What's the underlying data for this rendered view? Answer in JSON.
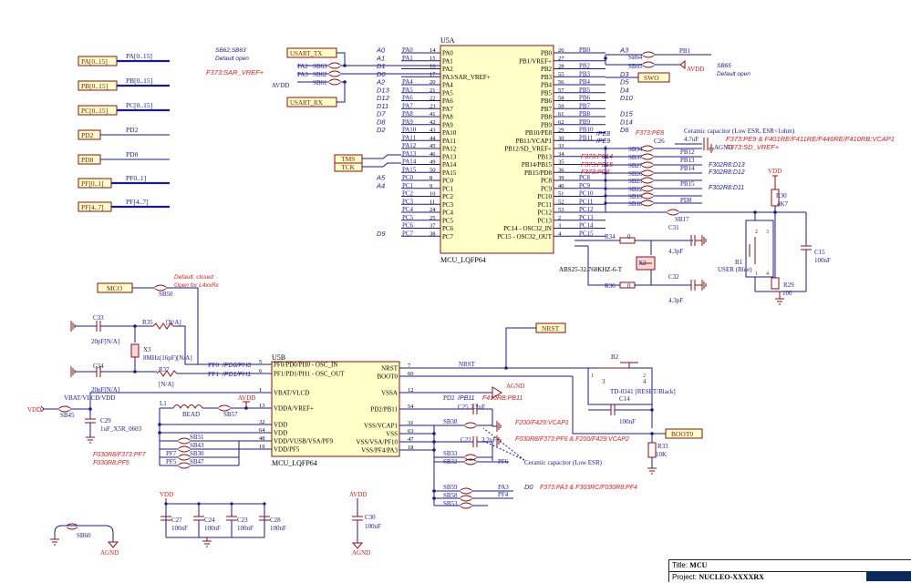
{
  "colors": {
    "net": "#1a1a8c",
    "part": "#8a1010",
    "alt": "#d42020",
    "label": "#7a1a1a",
    "chip_fill": "#ffffc8"
  },
  "u5a": {
    "ref": "U5A",
    "name": "MCU_LQFP64",
    "left_pins": [
      {
        "net": "PA0",
        "num": "14",
        "pin": "PA0",
        "alt": "A0"
      },
      {
        "net": "PA1",
        "num": "15",
        "pin": "PA1",
        "alt": "A1"
      },
      {
        "net": "",
        "num": "16",
        "pin": "PA2",
        "alt": "D1"
      },
      {
        "net": "",
        "num": "17",
        "pin": "PA3/SAR_VREF+",
        "alt": "D0"
      },
      {
        "net": "PA4",
        "num": "20",
        "pin": "PA4",
        "alt": "A2"
      },
      {
        "net": "PA5",
        "num": "21",
        "pin": "PA5",
        "alt": "D13"
      },
      {
        "net": "PA6",
        "num": "22",
        "pin": "PA6",
        "alt": "D12"
      },
      {
        "net": "PA7",
        "num": "23",
        "pin": "PA7",
        "alt": "D11"
      },
      {
        "net": "PA8",
        "num": "41",
        "pin": "PA8",
        "alt": "D7"
      },
      {
        "net": "PA9",
        "num": "42",
        "pin": "PA9",
        "alt": "D8"
      },
      {
        "net": "PA10",
        "num": "43",
        "pin": "PA10",
        "alt": "D2"
      },
      {
        "net": "PA11",
        "num": "44",
        "pin": "PA11",
        "alt": ""
      },
      {
        "net": "PA12",
        "num": "45",
        "pin": "PA12",
        "alt": ""
      },
      {
        "net": "PA13",
        "num": "46",
        "pin": "PA13",
        "alt": ""
      },
      {
        "net": "PA14",
        "num": "49",
        "pin": "PA14",
        "alt": ""
      },
      {
        "net": "PA15",
        "num": "50",
        "pin": "PA15",
        "alt": ""
      },
      {
        "net": "PC0",
        "num": "8",
        "pin": "PC0",
        "alt": "A5"
      },
      {
        "net": "PC1",
        "num": "9",
        "pin": "PC1",
        "alt": "A4"
      },
      {
        "net": "PC2",
        "num": "10",
        "pin": "PC2",
        "alt": ""
      },
      {
        "net": "PC3",
        "num": "11",
        "pin": "PC3",
        "alt": ""
      },
      {
        "net": "PC4",
        "num": "24",
        "pin": "PC4",
        "alt": ""
      },
      {
        "net": "PC5",
        "num": "25",
        "pin": "PC5",
        "alt": ""
      },
      {
        "net": "PC6",
        "num": "37",
        "pin": "PC6",
        "alt": ""
      },
      {
        "net": "PC7",
        "num": "38",
        "pin": "PC7",
        "alt": "D9"
      }
    ],
    "right_pins": [
      {
        "pin": "PB0",
        "num": "26",
        "net": "PB0",
        "alt": "A3"
      },
      {
        "pin": "PB1/VREF+",
        "num": "27",
        "net": "",
        "alt": ""
      },
      {
        "pin": "PB2",
        "num": "28",
        "net": "PB2",
        "alt": ""
      },
      {
        "pin": "PB3",
        "num": "55",
        "net": "PB3",
        "alt": "D3"
      },
      {
        "pin": "PB4",
        "num": "56",
        "net": "PB4",
        "alt": "D5"
      },
      {
        "pin": "PB5",
        "num": "57",
        "net": "PB5",
        "alt": "D4"
      },
      {
        "pin": "PB6",
        "num": "58",
        "net": "PB6",
        "alt": "D10"
      },
      {
        "pin": "PB7",
        "num": "59",
        "net": "PB7",
        "alt": ""
      },
      {
        "pin": "PB8",
        "num": "61",
        "net": "PB8",
        "alt": "D15"
      },
      {
        "pin": "PB9",
        "num": "62",
        "net": "PB9",
        "alt": "D14"
      },
      {
        "pin": "PB10/PE8",
        "num": "29",
        "net": "PB10",
        "alt": "D6"
      },
      {
        "pin": "PB11/VCAP1",
        "num": "30",
        "net": "PB11",
        "alt": ""
      },
      {
        "pin": "PB12/SD_VREF+",
        "num": "33",
        "net": "",
        "alt": ""
      },
      {
        "pin": "PB13",
        "num": "34",
        "net": "",
        "alt": ""
      },
      {
        "pin": "PB14/PB15",
        "num": "35",
        "net": "",
        "alt": ""
      },
      {
        "pin": "PB15/PD8",
        "num": "36",
        "net": "",
        "alt": ""
      },
      {
        "pin": "PC8",
        "num": "39",
        "net": "PC8",
        "alt": ""
      },
      {
        "pin": "PC9",
        "num": "40",
        "net": "PC9",
        "alt": ""
      },
      {
        "pin": "PC10",
        "num": "51",
        "net": "PC10",
        "alt": ""
      },
      {
        "pin": "PC11",
        "num": "52",
        "net": "PC11",
        "alt": ""
      },
      {
        "pin": "PC12",
        "num": "53",
        "net": "PC12",
        "alt": ""
      },
      {
        "pin": "PC13",
        "num": "2",
        "net": "PC13",
        "alt": ""
      },
      {
        "pin": "PC14 - OSC32_IN",
        "num": "3",
        "net": "PC14",
        "alt": ""
      },
      {
        "pin": "PC15 - OSC32_OUT",
        "num": "4",
        "net": "PC15",
        "alt": ""
      }
    ]
  },
  "u5b": {
    "ref": "U5B",
    "name": "MCU_LQFP64",
    "left_pins": [
      {
        "pin": "PF0/PD0/PH0 - OSC_IN",
        "num": "5"
      },
      {
        "pin": "PF1/PD1/PH1 - OSC_OUT",
        "num": "6"
      },
      {
        "pin": "VBAT/VLCD",
        "num": "1"
      },
      {
        "pin": "VDDA/VREF+",
        "num": "13"
      },
      {
        "pin": "VDD",
        "num": "32"
      },
      {
        "pin": "VDD",
        "num": "64"
      },
      {
        "pin": "VDD/VUSB/VSA/PF9",
        "num": "48"
      },
      {
        "pin": "VDD/PF5",
        "num": "19"
      }
    ],
    "right_pins": [
      {
        "pin": "NRST",
        "num": "7"
      },
      {
        "pin": "BOOT0",
        "num": "60"
      },
      {
        "pin": "VSSA",
        "num": "12"
      },
      {
        "pin": "PD2/PB11",
        "num": "54"
      },
      {
        "pin": "VSS/VCAP1",
        "num": "31"
      },
      {
        "pin": "VSS",
        "num": "63"
      },
      {
        "pin": "VSS/VSA/PF10",
        "num": "47"
      },
      {
        "pin": "VSS/PF4/PA3",
        "num": "18"
      }
    ]
  },
  "buses": [
    {
      "port": "PA[0..15]",
      "label": "PA[0..15]"
    },
    {
      "port": "PB[0..15]",
      "label": "PB[0..15]"
    },
    {
      "port": "PC[0..15]",
      "label": "PC[0..15]"
    },
    {
      "port": "PD2",
      "label": "PD2"
    },
    {
      "port": "PD8",
      "label": "PD8"
    },
    {
      "port": "PF[0..1]",
      "label": "PF0..1]"
    },
    {
      "port": "PF[4..7]",
      "label": "PF[4..7]"
    }
  ],
  "ports": {
    "usart_tx": "USART_TX",
    "usart_rx": "USART_RX",
    "tms": "TMS",
    "tck": "TCK",
    "swo": "SWO",
    "mco": "MCO",
    "nrst": "NRST",
    "boot0": "BOOT0"
  },
  "labels": {
    "sb62_63": "SB62,SB63",
    "default_open": "Default open",
    "f373_sar": "F373:SAR_VREF+",
    "sb63": "SB63",
    "sb62": "SB62",
    "sb61": "SB61",
    "pa2": "PA2",
    "pa3": "PA3",
    "avdd": "AVDD",
    "vdd": "VDD",
    "agnd": "AGND",
    "sb64": "SB64",
    "sb65": "SB65",
    "pb1": "PB1",
    "sb65_note": "SB65",
    "default_open2": "Default open",
    "f373_pe8": "F373:PE8",
    "pe8": "/PE8",
    "pe9": "/PE9",
    "ceramic1": "Ceramic capacitor (Low ESR, ESR<1ohm)",
    "c26": "C26",
    "c26v": "4.7uF",
    "f373_pe9": "F373:PE9 & F401RE/F411RE/F446RE/F410RB:VCAP1",
    "f373_sd": "F373:SD_VREF+",
    "f373_pb14": "F373:PB14",
    "f373_pb15": "F373:PB15",
    "f373_pd8": "F373:PD8",
    "sb34": "SB34",
    "sb37": "SB37",
    "sb27": "SB27",
    "sb26": "SB26",
    "sb23": "SB23",
    "sb22": "SB22",
    "sb19": "SB19",
    "sb18": "SB18",
    "sb17": "SB17",
    "pb12": "PB12",
    "pb13": "PB13",
    "pb14": "PB14",
    "pb15": "PB15",
    "pd8": "PD8",
    "f302_d13": "F302R8:D13",
    "f302_d12": "F302R8:D12",
    "f302_d11": "F302R8:D11",
    "vdd_top": "VDD",
    "r30": "R30",
    "r30v": "4K7",
    "r34": "R34",
    "r34v": "0",
    "c31": "C31",
    "c31v": "4.3pF",
    "x2": "X2",
    "x2v": "ABS25-32.768KHZ-6-T",
    "c32": "C32",
    "c32v": "4.3pF",
    "r36": "R36",
    "r36v": "0",
    "b1": "B1",
    "b1v": "USER (Blue)",
    "c15": "C15",
    "c15v": "100nF",
    "r29": "R29",
    "r29v": "100",
    "default_closed": "Default: closed",
    "open_l4": "Open for L4xxRx",
    "sb50": "SB50",
    "c33": "C33",
    "c33v": "20pF[N/A]",
    "r35": "R35",
    "r35v": "[N/A]",
    "x3": "X3",
    "x3v": "8MHz(16pF)[N/A]",
    "c34": "C34",
    "c34v": "20pF[N/A]",
    "r37": "R37",
    "r37v": "[N/A]",
    "pf0": "PF0",
    "pd0": "/PD0/PH0",
    "pf1": "PF1",
    "pd1": "/PD1/PH1",
    "vbat_net": "VBAT/VLCD/VDD",
    "sb45": "SB45",
    "c29": "C29",
    "c29v": "1uF_X5R_0603",
    "l1": "L1",
    "bead": "BEAD",
    "sb57": "SB57",
    "sb31": "SB31",
    "sb43": "SB43",
    "sb30": "SB30",
    "sb47": "SB47",
    "pf7": "PF7",
    "pf5": "PF5",
    "f030_pf7": "F030R8/F373:PF7",
    "f030_pf5": "F030R8:PF5",
    "nrst_w": "NRST",
    "b2": "B2",
    "b2v": "TD-0341 [RESET/Black]",
    "c14": "C14",
    "c14v": "100nF",
    "pd2": "PD2",
    "pb11": "/PB11",
    "f410": "F410RB:PB11",
    "c25": "C25",
    "c25v": "2.2uF",
    "sb38": "SB38",
    "c22": "C22",
    "c22v": "2.2uF",
    "f200": "F200/F429:VCAP1",
    "f030_pf6": "F030R8/F373:PF6 & F200/F429:VCAP2",
    "sb33": "SB33",
    "sb32": "SB32",
    "pf6": "PF6",
    "ceramic2": "Ceramic capacitor (Low ESR)",
    "r33": "R33",
    "r33v": "10K",
    "sb59": "SB59",
    "sb58": "SB58",
    "sb53": "SB53",
    "pa3b": "PA3",
    "pf4": "PF4",
    "d0": "D0",
    "f373_pa3": "F373:PA3 & F303RC/F030R8:PF4",
    "c27": "C27",
    "c24": "C24",
    "c23": "C23",
    "c28": "C28",
    "c30": "C30",
    "cv": "100nF",
    "sb60": "SB60"
  },
  "title_block": {
    "title_label": "Title:",
    "title": "MCU",
    "project_label": "Project:",
    "project": "NUCLEO-XXXXRX"
  }
}
